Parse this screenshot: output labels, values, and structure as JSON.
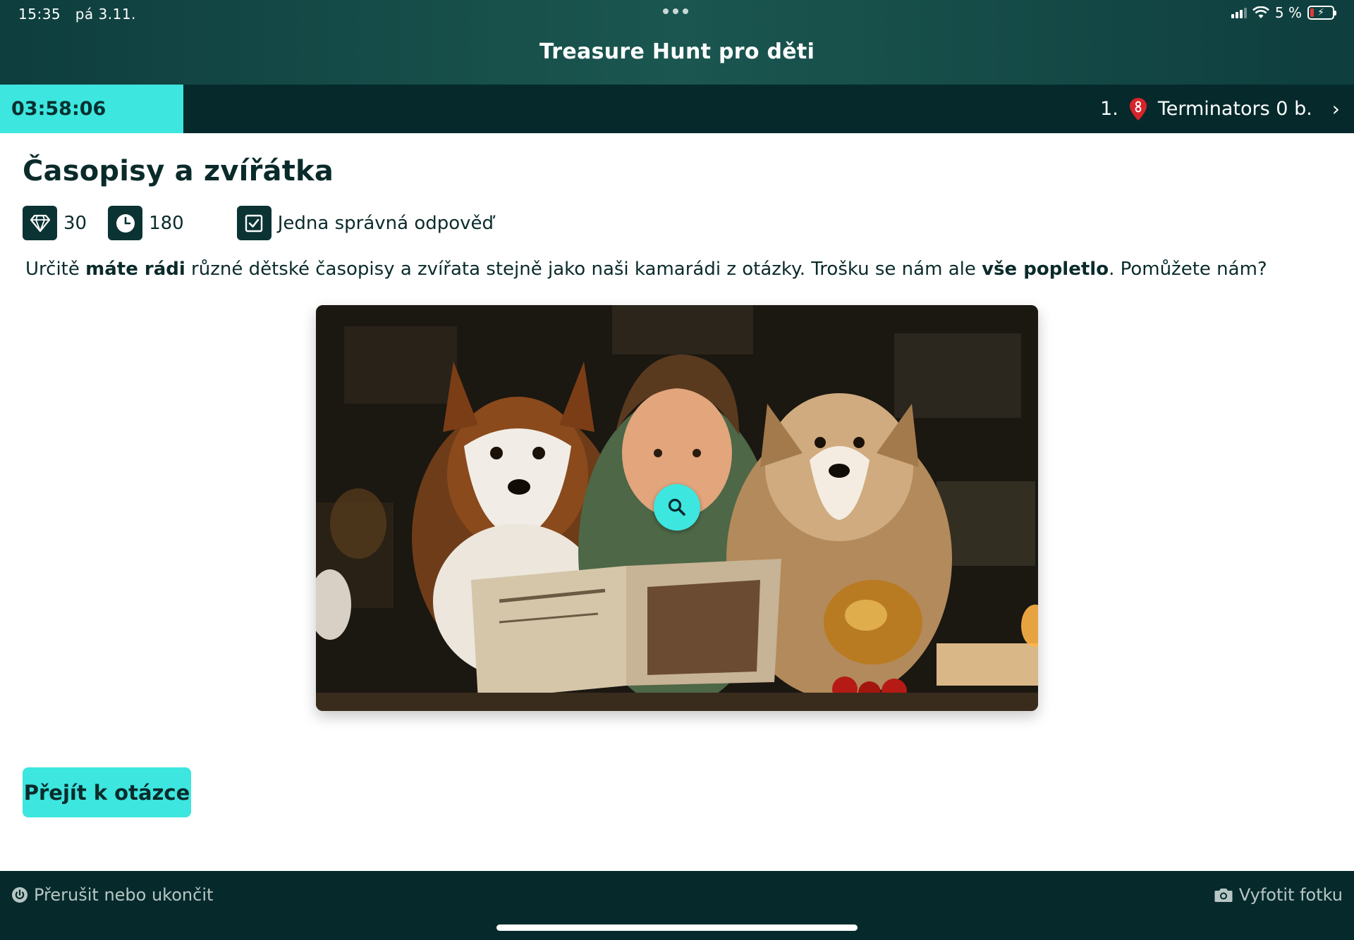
{
  "status_bar": {
    "time": "15:35",
    "date": "pá 3.11.",
    "battery": "5 %"
  },
  "header": {
    "title": "Treasure Hunt pro děti"
  },
  "timer_bar": {
    "timer": "03:58:06",
    "rank": "1.",
    "team": "Terminators 0 b.",
    "accent_color": "#3de6df",
    "background_color": "#062a2c"
  },
  "task": {
    "title": "Časopisy a zvířátka",
    "points": "30",
    "time_limit": "180",
    "answer_type": "Jedna správná odpověď",
    "description": {
      "part1": "Určitě ",
      "bold1": "máte rádi",
      "part2": " různé dětské časopisy a zvířata stejně jako naši kamarádi z otázky. Trošku se nám ale ",
      "bold2": "vše popletlo",
      "part3": ". Pomůžete nám?"
    }
  },
  "actions": {
    "go_to_question": "Přejít k otázce"
  },
  "bottom_bar": {
    "stop": "Přerušit nebo ukončit",
    "photo": "Vyfotit fotku"
  },
  "icons": {
    "points": "diamond-icon",
    "time": "clock-icon",
    "answer_type": "checkbox-icon",
    "team": "location-pin-icon",
    "zoom": "search-icon",
    "stop": "power-icon",
    "photo": "camera-icon"
  }
}
